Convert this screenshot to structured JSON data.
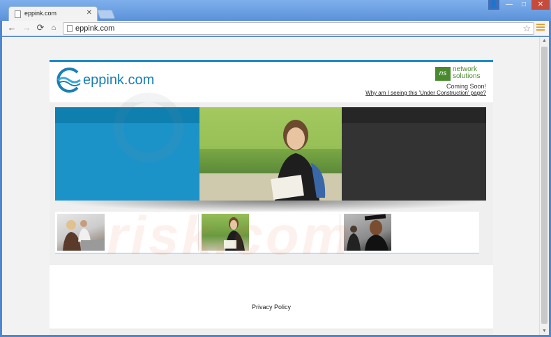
{
  "browser": {
    "tab_title": "eppink.com",
    "tab_close": "✕",
    "url": "eppink.com",
    "window_controls": {
      "user": "👤",
      "minimize": "—",
      "maximize": "□",
      "close": "✕"
    },
    "nav": {
      "back": "←",
      "forward": "→",
      "reload": "⟳",
      "home": "⌂",
      "bookmark_star": "☆"
    }
  },
  "site": {
    "logo_text": "eppink.com",
    "provider_badge": "ns",
    "provider_name_line1": "network",
    "provider_name_line2": "solutions",
    "coming_soon": "Coming Soon!",
    "why_link": "Why am I seeing this 'Under Construction' page?",
    "privacy_link": "Privacy Policy"
  },
  "watermark": "risk.com",
  "colors": {
    "accent_blue": "#1d8cc3",
    "hero_left": "#1c93c8",
    "hero_right": "#333333",
    "provider_green": "#4a8a2e"
  }
}
